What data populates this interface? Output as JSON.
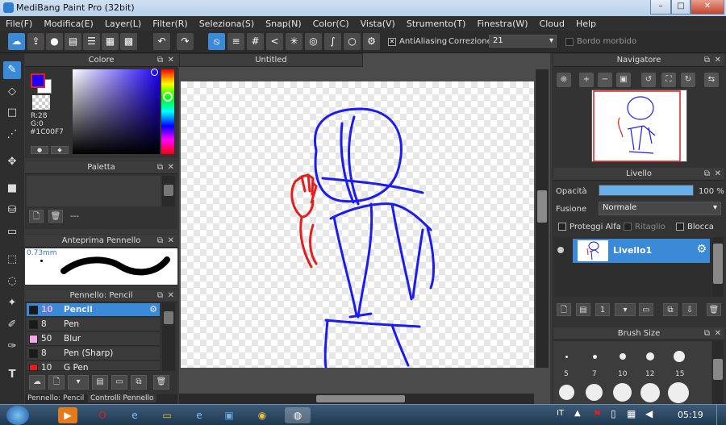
{
  "window": {
    "title": "MediBang Paint Pro (32bit)"
  },
  "menu": [
    "File(F)",
    "Modifica(E)",
    "Layer(L)",
    "Filter(R)",
    "Seleziona(S)",
    "Snap(N)",
    "Color(C)",
    "Vista(V)",
    "Strumento(T)",
    "Finestra(W)",
    "Cloud",
    "Help"
  ],
  "toolbar": {
    "antialiasing_label": "AntiAliasing",
    "correzione_label": "Correzione",
    "correzione_value": "21",
    "bordo_label": "Bordo morbido"
  },
  "color_panel": {
    "title": "Colore",
    "r": "R:28",
    "g": "G:0",
    "hex": "#1C00F7",
    "fg": "#1c00f7",
    "bg": "#ffffff"
  },
  "palette_panel": {
    "title": "Paletta",
    "value": "---"
  },
  "brush_preview": {
    "title": "Anteprima Pennello",
    "size": "0.73mm"
  },
  "brush_panel": {
    "title": "Pennello: Pencil",
    "items": [
      {
        "size": "10",
        "name": "Pencil",
        "color": "#1a1a1a"
      },
      {
        "size": "8",
        "name": "Pen",
        "color": "#1a1a1a"
      },
      {
        "size": "50",
        "name": "Blur",
        "color": "#f4a6e6"
      },
      {
        "size": "8",
        "name": "Pen (Sharp)",
        "color": "#1a1a1a"
      },
      {
        "size": "10",
        "name": "G Pen",
        "color": "#e02020"
      }
    ],
    "tabs": [
      "Pennello: Pencil",
      "Controlli Pennello"
    ]
  },
  "canvas": {
    "tab": "Untitled"
  },
  "navigator": {
    "title": "Navigatore"
  },
  "layer_panel": {
    "title": "Livello",
    "opacity_label": "Opacità",
    "opacity_value": "100 %",
    "opacity_fraction": 1.0,
    "blend_label": "Fusione",
    "blend_value": "Normale",
    "protect_alpha": "Proteggi Alfa",
    "clipping": "Ritaglio",
    "lock": "Blocca",
    "layer_name": "Livello1"
  },
  "brush_size": {
    "title": "Brush Size",
    "sizes": [
      "5",
      "7",
      "10",
      "12",
      "15"
    ]
  },
  "taskbar": {
    "lang": "IT",
    "clock": "05:19"
  }
}
